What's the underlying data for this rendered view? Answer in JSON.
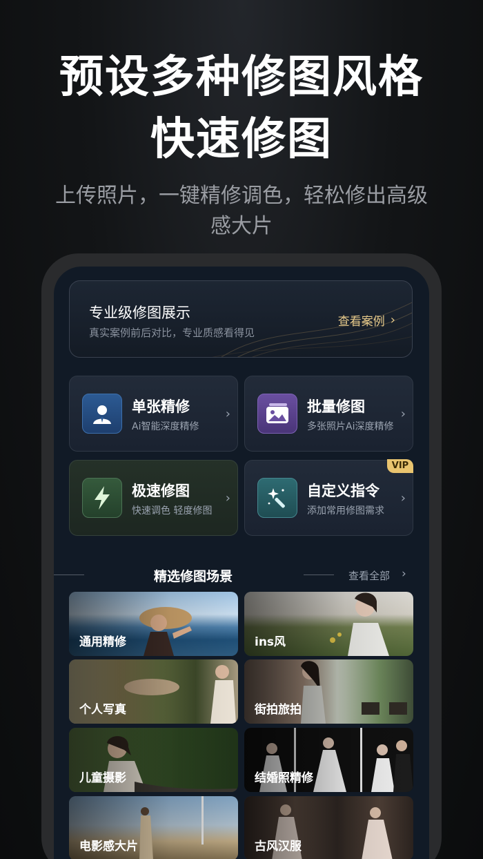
{
  "hero": {
    "line1": "预设多种修图风格",
    "line2": "快速修图",
    "subtitle": "上传照片，一键精修调色，轻松修出高级感大片"
  },
  "banner": {
    "title": "专业级修图展示",
    "desc": "真实案例前后对比，专业质感看得见",
    "link": "查看案例"
  },
  "cards": [
    {
      "title": "单张精修",
      "desc": "Ai智能深度精修",
      "icon": "portrait-icon"
    },
    {
      "title": "批量修图",
      "desc": "多张照片Ai深度精修",
      "icon": "gallery-icon"
    },
    {
      "title": "极速修图",
      "desc": "快速调色   轻度修图",
      "icon": "lightning-icon"
    },
    {
      "title": "自定义指令",
      "desc": "添加常用修图需求",
      "icon": "magic-wand-icon",
      "badge": "VIP"
    }
  ],
  "section": {
    "title": "精选修图场景",
    "more": "查看全部"
  },
  "scenes": [
    {
      "label": "通用精修"
    },
    {
      "label": "ins风"
    },
    {
      "label": "个人写真"
    },
    {
      "label": "街拍旅拍"
    },
    {
      "label": "儿童摄影"
    },
    {
      "label": "结婚照精修"
    },
    {
      "label": "电影感大片"
    },
    {
      "label": "古风汉服"
    }
  ],
  "colors": {
    "accent_gold": "#e6c98a",
    "vip_badge": "#e9c46f",
    "screen_bg": "#111a26"
  }
}
